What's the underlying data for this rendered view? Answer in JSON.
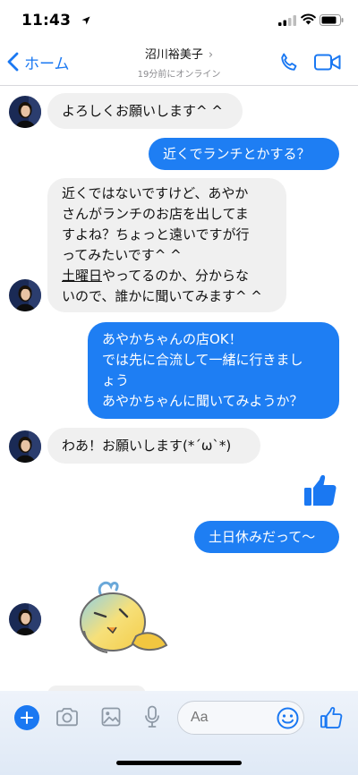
{
  "status": {
    "time": "11:43"
  },
  "header": {
    "back_label": "ホーム",
    "contact_name": "沼川裕美子",
    "contact_status": "19分前にオンライン"
  },
  "messages": [
    {
      "from": "them",
      "text": "よろしくお願いします^ ^"
    },
    {
      "from": "me",
      "text": "近くでランチとかする？"
    },
    {
      "from": "them",
      "lines": [
        "近くではないですけど、あやか",
        "さんがランチのお店を出してま",
        "すよね？ちょっと遠いですが行",
        "ってみたいです^ ^"
      ],
      "underlined": "土曜日",
      "after_underline": "やってるのか、分からな",
      "last_line": "いので、誰かに聞いてみます^ ^"
    },
    {
      "from": "me",
      "text": "あやかちゃんの店OK！\nでは先に合流して一緒に行きまし\nょう\nあやかちゃんに聞いてみようか？"
    },
    {
      "from": "them",
      "text": "わあ！お願いします(*´ω`*)"
    },
    {
      "from": "me",
      "type": "like-sticker"
    },
    {
      "from": "me",
      "text": "土日休みだって〜"
    },
    {
      "from": "them",
      "type": "sticker"
    }
  ],
  "composer": {
    "placeholder": "Aa"
  },
  "colors": {
    "accent": "#1a78f2",
    "outgoing_bubble": "#1e7ef3",
    "incoming_bubble": "#f0f0f0"
  },
  "icons": [
    "location-arrow-icon",
    "signal-icon",
    "wifi-icon",
    "battery-icon",
    "chevron-left-icon",
    "chevron-right-icon",
    "phone-icon",
    "video-camera-icon",
    "plus-icon",
    "camera-icon",
    "image-icon",
    "microphone-icon",
    "emoji-icon",
    "thumbs-up-icon"
  ]
}
